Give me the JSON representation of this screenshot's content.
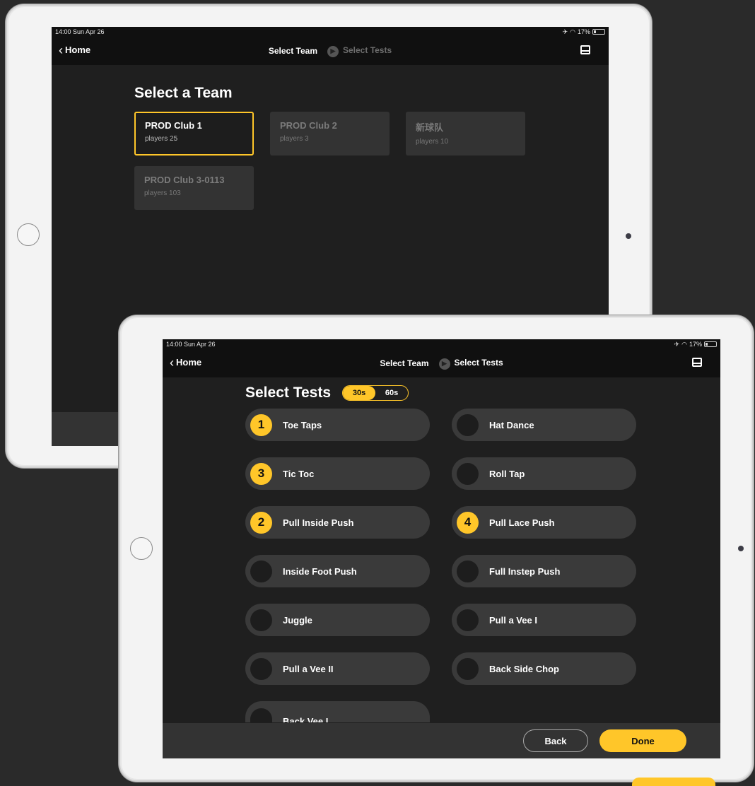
{
  "colors": {
    "accent": "#ffc629",
    "screen_bg": "#1f1f1f",
    "card_bg": "#333333",
    "pill_bg": "#3a3a3a"
  },
  "back_screen": {
    "status": {
      "time": "14:00  Sun Apr 26",
      "battery": "17%"
    },
    "nav": {
      "home_label": "Home",
      "step1": "Select Team",
      "step2": "Select Tests"
    },
    "title": "Select a Team",
    "teams": [
      {
        "name": "PROD Club 1",
        "players": "players 25",
        "selected": true
      },
      {
        "name": "PROD Club 2",
        "players": "players 3",
        "selected": false
      },
      {
        "name": "新球队",
        "players": "players 10",
        "selected": false
      },
      {
        "name": "PROD Club 3-0113",
        "players": "players 103",
        "selected": false
      }
    ]
  },
  "front_screen": {
    "status": {
      "time": "14:00  Sun Apr 26",
      "battery": "17%"
    },
    "nav": {
      "home_label": "Home",
      "step1": "Select Team",
      "step2": "Select Tests"
    },
    "title": "Select Tests",
    "duration": {
      "options": [
        "30s",
        "60s"
      ],
      "selected": "30s"
    },
    "tests": [
      {
        "label": "Toe Taps",
        "order": "1"
      },
      {
        "label": "Hat Dance",
        "order": ""
      },
      {
        "label": "Tic Toc",
        "order": "3"
      },
      {
        "label": "Roll Tap",
        "order": ""
      },
      {
        "label": "Pull Inside Push",
        "order": "2"
      },
      {
        "label": "Pull Lace Push",
        "order": "4"
      },
      {
        "label": "Inside Foot Push",
        "order": ""
      },
      {
        "label": "Full Instep Push",
        "order": ""
      },
      {
        "label": "Juggle",
        "order": ""
      },
      {
        "label": "Pull a Vee I",
        "order": ""
      },
      {
        "label": "Pull a Vee II",
        "order": ""
      },
      {
        "label": "Back Side Chop",
        "order": ""
      }
    ],
    "partial_test": {
      "label": "Back Vee I"
    },
    "buttons": {
      "back": "Back",
      "done": "Done"
    }
  }
}
